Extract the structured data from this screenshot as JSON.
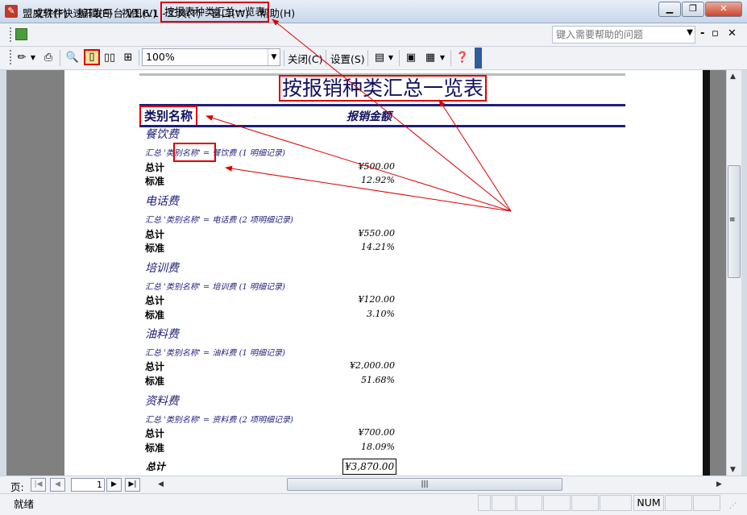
{
  "window": {
    "app_title": "盟威软件快速开发平台 V1.6.1 -",
    "doc_title": "按报表种类汇总一览表",
    "minimize_icon": "minimize-icon",
    "restore_icon": "restore-icon",
    "close_icon": "close-icon"
  },
  "menu": {
    "items": [
      "文件(F)",
      "编辑(E)",
      "视图(V)",
      "工具(T)",
      "窗口(W)",
      "帮助(H)"
    ],
    "help_placeholder": "键入需要帮助的问题"
  },
  "toolbar": {
    "zoom": "100%",
    "close_label": "关闭(C)",
    "setup_label": "设置(S)"
  },
  "report": {
    "title": "按报销种类汇总一览表",
    "col_category": "类别名称",
    "col_amount": "报销金额",
    "total_label": "总计",
    "std_label": "标准",
    "groups": [
      {
        "name": "餐饮费",
        "summary": "汇总 '类别名称' = 餐饮费 (1 明细记录)",
        "total": "¥500.00",
        "std": "12.92%"
      },
      {
        "name": "电话费",
        "summary": "汇总 '类别名称' = 电话费 (2 项明细记录)",
        "total": "¥550.00",
        "std": "14.21%"
      },
      {
        "name": "培训费",
        "summary": "汇总 '类别名称' = 培训费 (1 明细记录)",
        "total": "¥120.00",
        "std": "3.10%"
      },
      {
        "name": "油料费",
        "summary": "汇总 '类别名称' = 油料费 (1 明细记录)",
        "total": "¥2,000.00",
        "std": "51.68%"
      },
      {
        "name": "资料费",
        "summary": "汇总 '类别名称' = 资料费 (2 项明细记录)",
        "total": "¥700.00",
        "std": "18.09%"
      }
    ],
    "grand_total_label": "总计",
    "grand_total": "¥3,870.00"
  },
  "nav": {
    "page_label": "页:",
    "page_value": "1"
  },
  "status": {
    "text": "就绪",
    "num": "NUM"
  },
  "colors": {
    "highlight": "#dd0000",
    "report_navy": "#1c1e7a"
  }
}
